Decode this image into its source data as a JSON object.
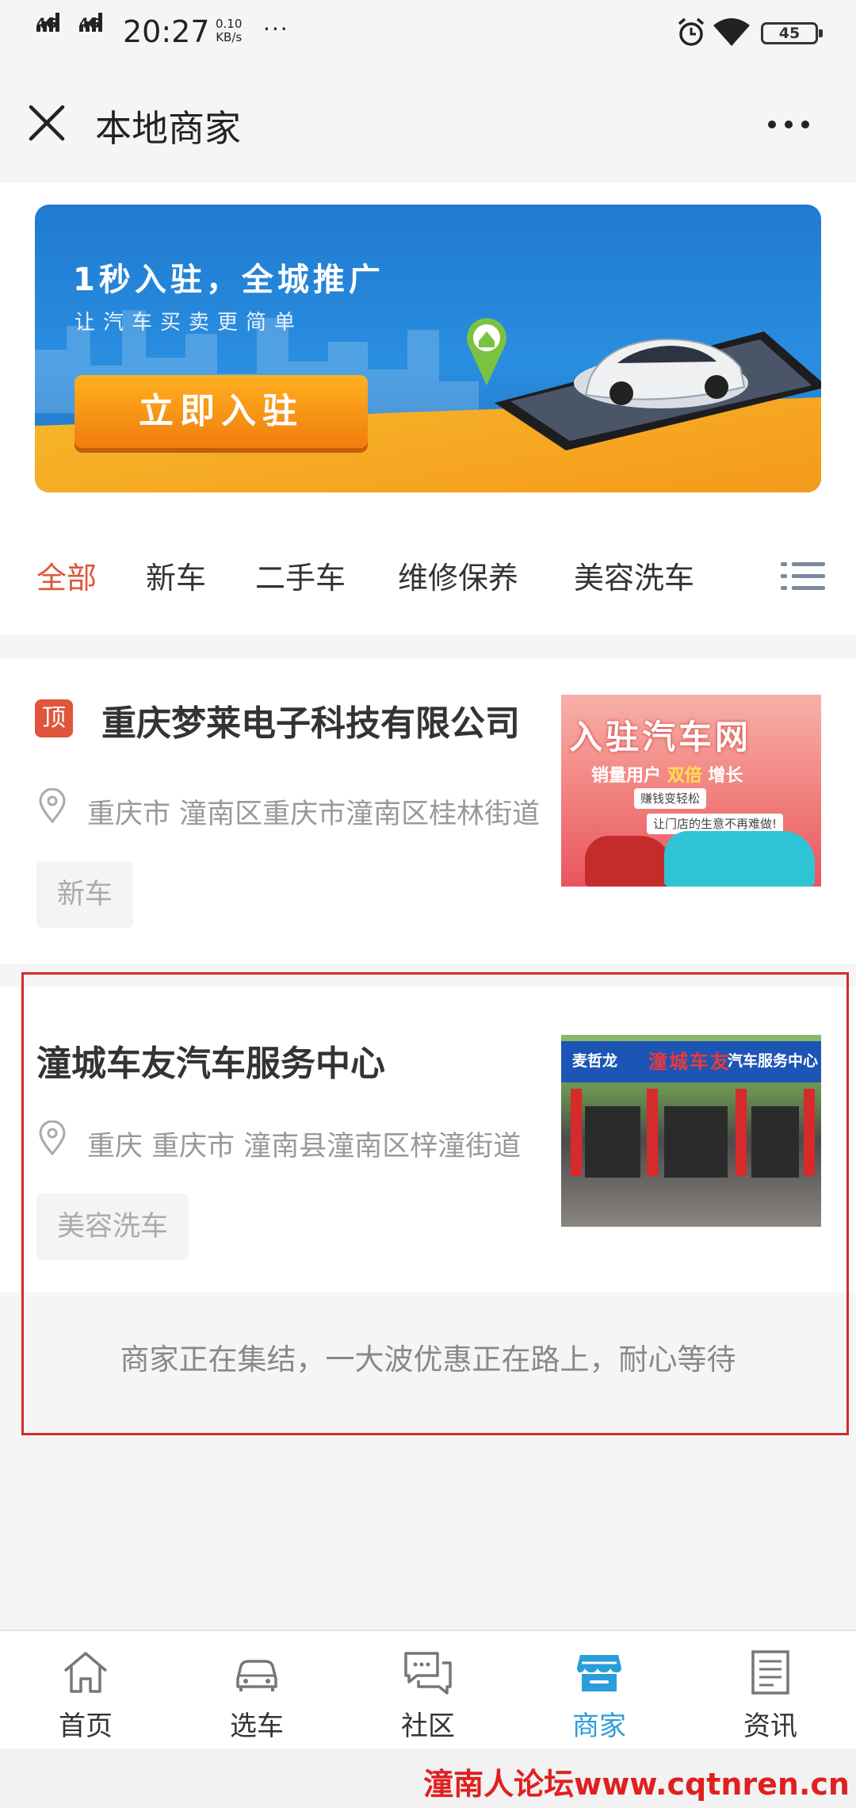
{
  "status_bar": {
    "network_1": "4G",
    "network_2": "4G",
    "time": "20:27",
    "speed_value": "0.10",
    "speed_unit": "KB/s",
    "more": "···",
    "battery": "45"
  },
  "nav": {
    "title": "本地商家",
    "close_icon": "close-icon",
    "more_icon": "more-icon"
  },
  "banner": {
    "headline": "1秒入驻，全城推广",
    "subtitle": "让汽车买卖更简单",
    "cta_label": "立即入驻"
  },
  "tabs": [
    {
      "label": "全部",
      "active": true
    },
    {
      "label": "新车",
      "active": false
    },
    {
      "label": "二手车",
      "active": false
    },
    {
      "label": "维修保养",
      "active": false
    },
    {
      "label": "美容洗车",
      "active": false
    }
  ],
  "merchants": [
    {
      "badge": "顶",
      "name": "重庆梦莱电子科技有限公司",
      "address": "重庆市 潼南区重庆市潼南区桂林街道",
      "tag": "新车",
      "thumb": {
        "title": "入驻汽车网",
        "line_1": "销量用户",
        "line_2": "双倍",
        "line_3": "增长",
        "chip_1": "赚钱变轻松",
        "chip_2": "让门店的生意不再难做!"
      }
    },
    {
      "name": "潼城车友汽车服务中心",
      "address": "重庆 重庆市 潼南县潼南区梓潼街道",
      "tag": "美容洗车",
      "thumb": {
        "brand": "麦哲龙",
        "name": "潼城车友",
        "shop": "汽车服务中心"
      }
    }
  ],
  "end_tip": "商家正在集结，一大波优惠正在路上，耐心等待",
  "bottom_nav": [
    {
      "label": "首页",
      "icon": "home-icon",
      "active": false
    },
    {
      "label": "选车",
      "icon": "car-icon",
      "active": false
    },
    {
      "label": "社区",
      "icon": "chat-icon",
      "active": false
    },
    {
      "label": "商家",
      "icon": "shop-icon",
      "active": true
    },
    {
      "label": "资讯",
      "icon": "news-icon",
      "active": false
    }
  ],
  "colors": {
    "accent": "#e0553b",
    "active_nav": "#2a9ddb",
    "highlight_border": "#d42a2a"
  },
  "watermark": "潼南人论坛www.cqtnren.cn"
}
